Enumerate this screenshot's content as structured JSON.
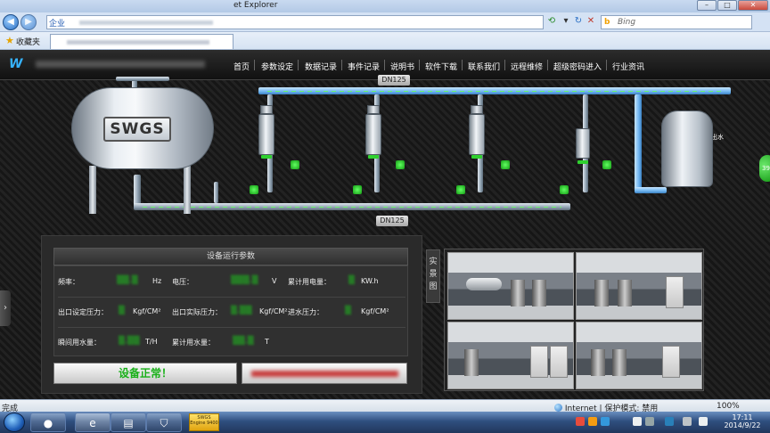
{
  "browser": {
    "title": "et Explorer",
    "address_category": "企业",
    "search_placeholder": "Bing",
    "search_brand": "b",
    "favorites_label": "收藏夹"
  },
  "nav": {
    "logo": "W",
    "items": [
      "首页",
      "参数设定",
      "数据记录",
      "事件记录",
      "说明书",
      "软件下载",
      "联系我们",
      "远程维修",
      "超级密码进入",
      "行业资讯"
    ]
  },
  "diagram": {
    "tank_label": "SWGS",
    "dn_top": "DN125",
    "dn_bottom": "DN125",
    "outlet_label": "用户出水"
  },
  "params": {
    "title": "设备运行参数",
    "frequency_label": "频率：",
    "frequency_unit": "Hz",
    "voltage_label": "电压：",
    "voltage_unit": "V",
    "energy_label": "累计用电量：",
    "energy_unit": "KW.h",
    "outlet_set_label": "出口设定压力：",
    "outlet_set_unit": "Kgf/CM²",
    "outlet_actual_label": "出口实际压力：",
    "outlet_actual_unit": "Kgf/CM²",
    "inlet_label": "进水压力：",
    "inlet_unit": "Kgf/CM²",
    "flow_label": "瞬间用水量：",
    "flow_unit": "T/H",
    "total_water_label": "累计用水量：",
    "total_water_unit": "T"
  },
  "status_button": "设备正常！",
  "scene_label": "实景图",
  "side_badge": "39",
  "statusbar": {
    "done": "完成",
    "zone": "Internet | 保护模式: 禁用",
    "zoom": "100%"
  },
  "taskbar": {
    "app_label": "SWGS Engine 9400",
    "time": "17:11",
    "date": "2014/9/22"
  },
  "colors": {
    "value_green": "#1dc21d",
    "status_green": "#18b018",
    "accent_blue": "#36b3ff"
  }
}
